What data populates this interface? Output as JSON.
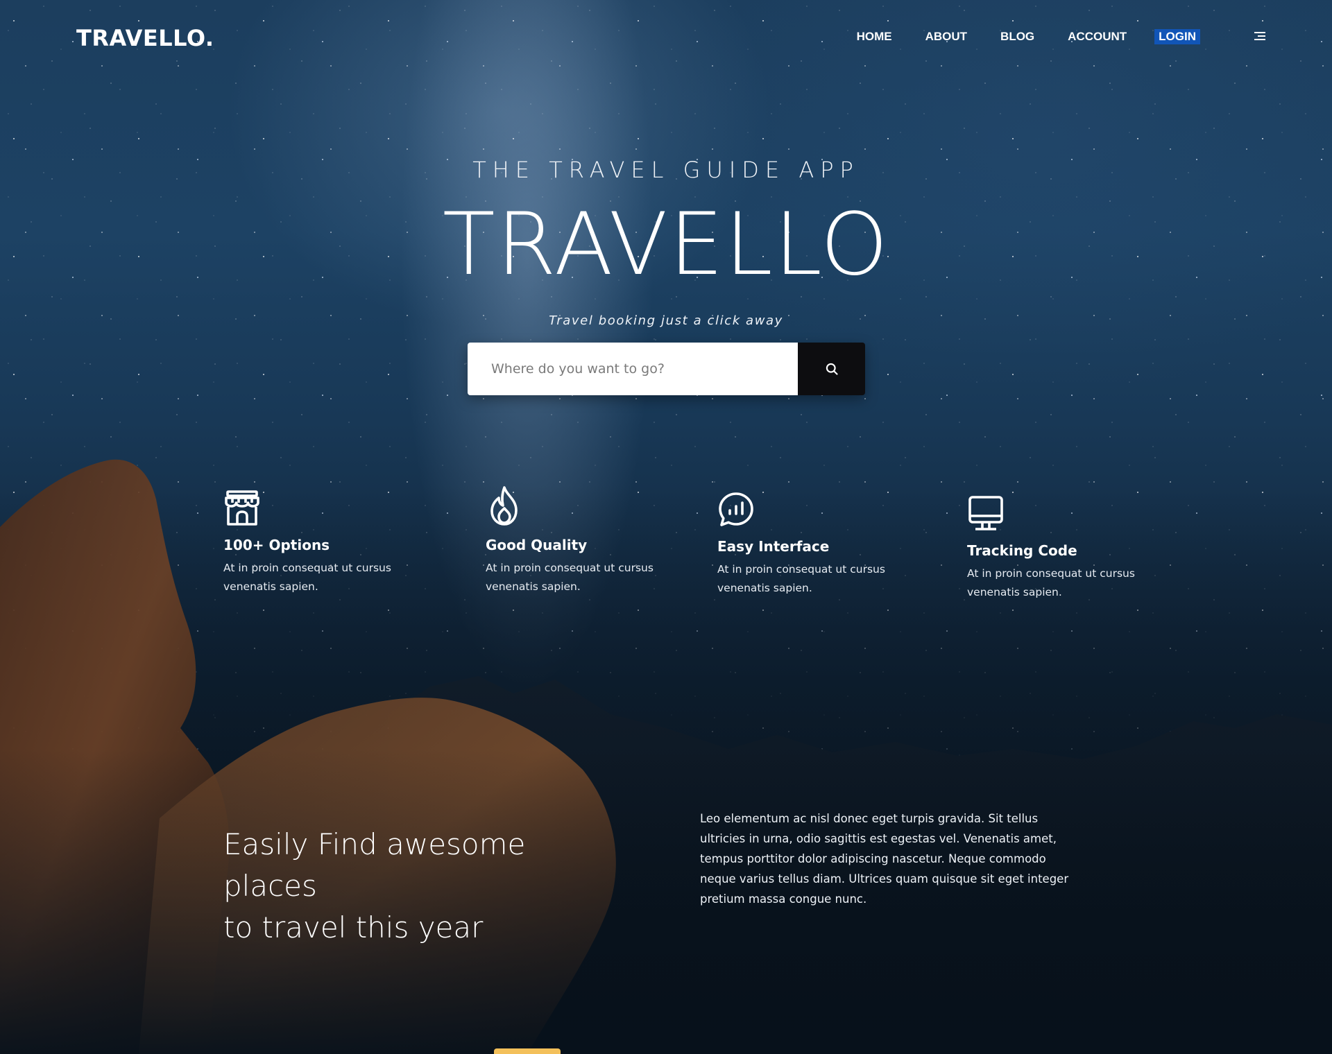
{
  "header": {
    "logo": "TRAVELLO.",
    "nav": [
      {
        "label": "HOME"
      },
      {
        "label": "ABOUT"
      },
      {
        "label": "BLOG"
      },
      {
        "label": "ACCOUNT"
      },
      {
        "label": "LOGIN"
      }
    ],
    "menu_icon": "hamburger-menu-icon"
  },
  "hero": {
    "kicker": "THE TRAVEL GUIDE APP",
    "title": "TRAVELLO",
    "tagline": "Travel booking just a click away",
    "search": {
      "placeholder": "Where do you want to go?",
      "value": "",
      "button_icon": "search-icon"
    }
  },
  "features": [
    {
      "icon": "store-icon",
      "title": "100+ Options",
      "text": "At in proin consequat ut cursus venenatis sapien."
    },
    {
      "icon": "flame-icon",
      "title": "Good Quality",
      "text": "At in proin consequat ut cursus venenatis sapien."
    },
    {
      "icon": "chat-chart-icon",
      "title": "Easy Interface",
      "text": "At in proin consequat ut cursus venenatis sapien."
    },
    {
      "icon": "monitor-icon",
      "title": "Tracking Code",
      "text": "At in proin consequat ut cursus venenatis sapien."
    }
  ],
  "lower": {
    "title_line1": "Easily Find awesome places",
    "title_line2": "to travel this year",
    "text": "Leo elementum ac nisl donec eget turpis gravida. Sit tellus ultricies in urna, odio sagittis est egestas vel. Venenatis amet, tempus porttitor dolor adipiscing nascetur. Neque commodo neque varius tellus diam. Ultrices quam quisque sit eget integer pretium massa congue nunc."
  },
  "colors": {
    "login_accent": "#1155b7",
    "search_button": "#0d0d10",
    "bottom_tab": "#f3c05b"
  }
}
